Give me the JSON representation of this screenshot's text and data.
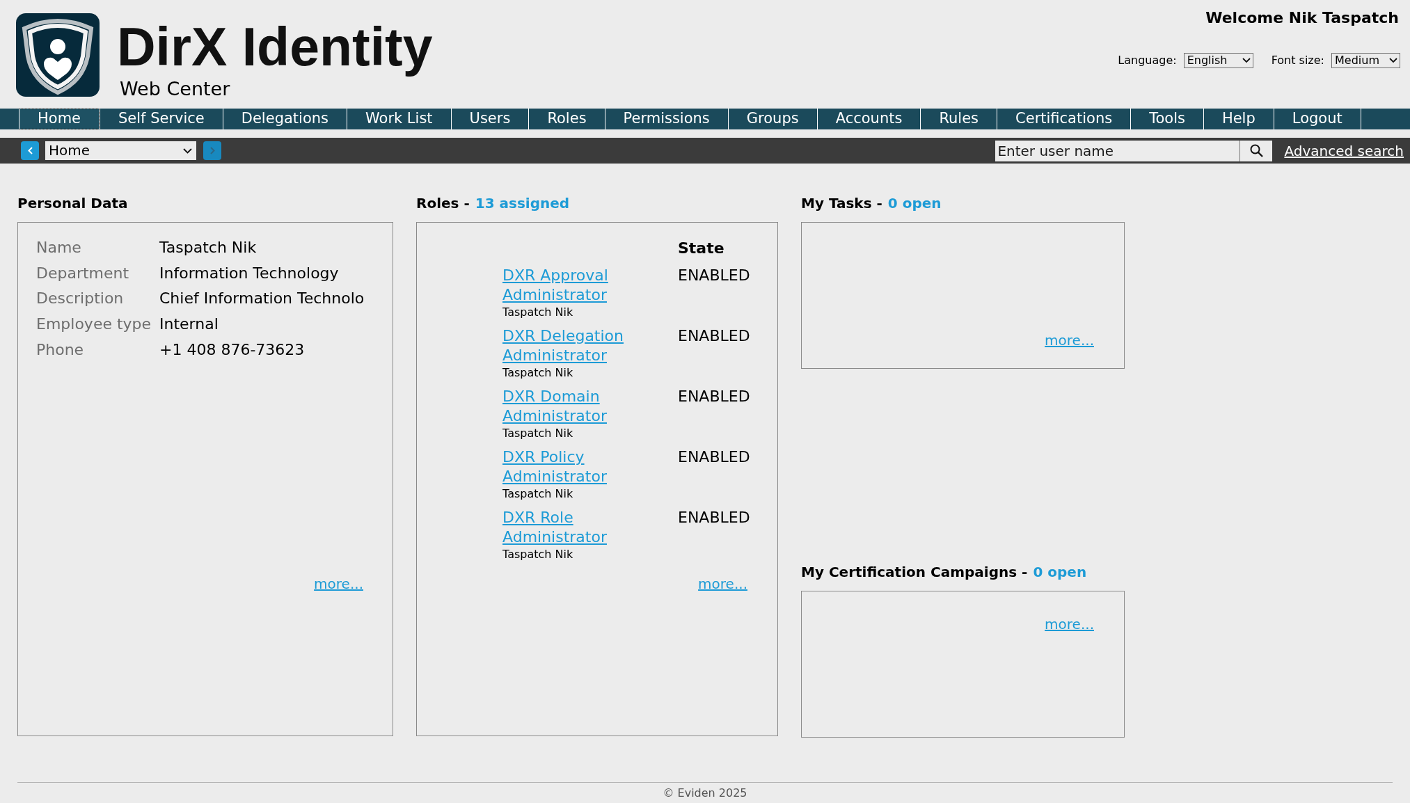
{
  "header": {
    "logo_title": "DirX Identity",
    "logo_subtitle": "Web Center",
    "welcome": "Welcome Nik Taspatch",
    "language": {
      "label": "Language:",
      "value": "English"
    },
    "font_size": {
      "label": "Font size:",
      "value": "Medium"
    }
  },
  "nav": [
    {
      "label": "Home",
      "selected": true
    },
    {
      "label": "Self Service",
      "selected": false
    },
    {
      "label": "Delegations",
      "selected": false
    },
    {
      "label": "Work List",
      "selected": false
    },
    {
      "label": "Users",
      "selected": false
    },
    {
      "label": "Roles",
      "selected": false
    },
    {
      "label": "Permissions",
      "selected": false
    },
    {
      "label": "Groups",
      "selected": false
    },
    {
      "label": "Accounts",
      "selected": false
    },
    {
      "label": "Rules",
      "selected": false
    },
    {
      "label": "Certifications",
      "selected": false
    },
    {
      "label": "Tools",
      "selected": false
    },
    {
      "label": "Help",
      "selected": false
    },
    {
      "label": "Logout",
      "selected": false
    }
  ],
  "toolbar": {
    "back_button": {
      "disabled": false
    },
    "page_select": "Home",
    "forward_button": {
      "disabled": true
    },
    "search": {
      "placeholder": "Enter user name"
    },
    "advanced_search": "Advanced search"
  },
  "personal_data": {
    "title": "Personal Data",
    "fields": [
      {
        "label": "Name",
        "value": "Taspatch Nik"
      },
      {
        "label": "Department",
        "value": "Information Technology"
      },
      {
        "label": "Description",
        "value": "Chief Information Technolo"
      },
      {
        "label": "Employee type",
        "value": "Internal"
      },
      {
        "label": "Phone",
        "value": "+1 408 876-73623"
      }
    ],
    "more": "more..."
  },
  "roles": {
    "title": "Roles -",
    "count": "13 assigned",
    "state_header": "State",
    "items": [
      {
        "name": "DXR Approval Administrator",
        "owner": "Taspatch Nik",
        "state": "ENABLED"
      },
      {
        "name": "DXR Delegation Administrator",
        "owner": "Taspatch Nik",
        "state": "ENABLED"
      },
      {
        "name": "DXR Domain Administrator",
        "owner": "Taspatch Nik",
        "state": "ENABLED"
      },
      {
        "name": "DXR Policy Administrator",
        "owner": "Taspatch Nik",
        "state": "ENABLED"
      },
      {
        "name": "DXR Role Administrator",
        "owner": "Taspatch Nik",
        "state": "ENABLED"
      }
    ],
    "more": "more..."
  },
  "tasks": {
    "title": "My Tasks -",
    "count": "0 open",
    "more": "more..."
  },
  "campaigns": {
    "title": "My Certification Campaigns -",
    "count": "0 open",
    "more": "more..."
  },
  "footer": "© Eviden 2025"
}
